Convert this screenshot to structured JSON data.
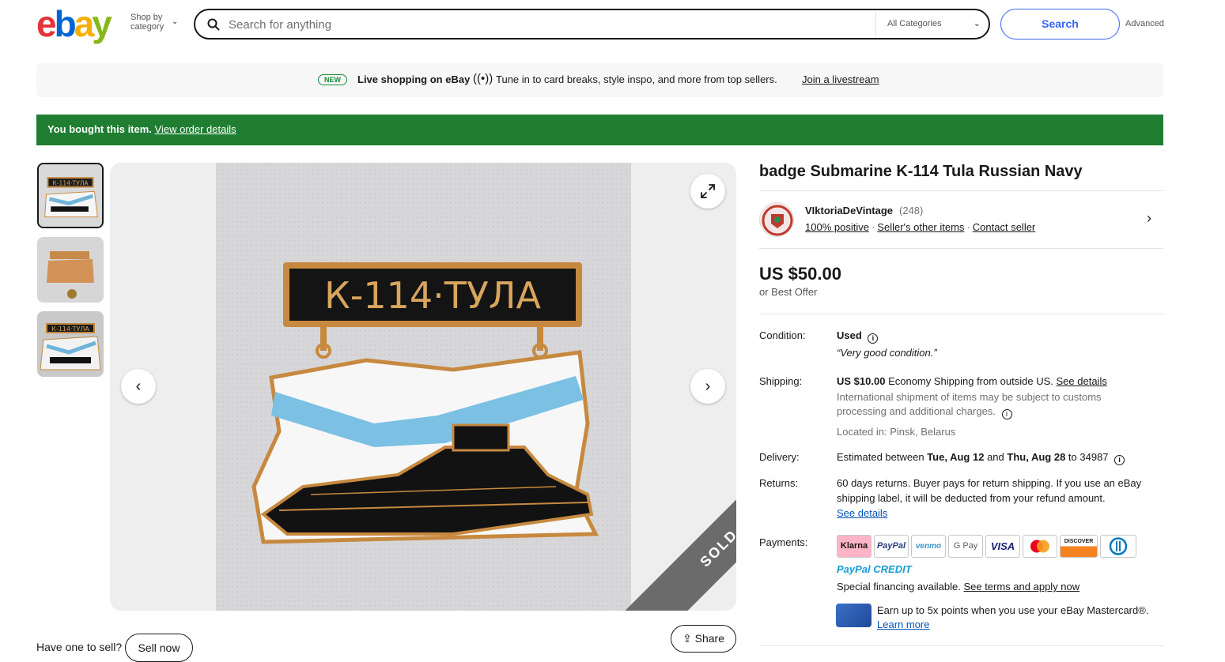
{
  "header": {
    "logo": {
      "e": "e",
      "b": "b",
      "a": "a",
      "y": "y"
    },
    "shop_by_line1": "Shop by",
    "shop_by_line2": "category",
    "search_placeholder": "Search for anything",
    "category_select": "All Categories",
    "search_button": "Search",
    "advanced_link": "Advanced"
  },
  "live_banner": {
    "badge": "NEW",
    "title": "Live shopping on eBay",
    "text": "Tune in to card breaks, style inspo, and more from top sellers.",
    "link": "Join a livestream"
  },
  "purchase_bar": {
    "text": "You bought this item.",
    "link": "View order details",
    "color": "#1f7e32"
  },
  "gallery": {
    "badge_text": "К-114·ТУЛА",
    "sold_label": "SOLD",
    "thumbnails": [
      "front",
      "back",
      "angled"
    ]
  },
  "listing": {
    "title": "badge Submarine K-114 Tula Russian Navy",
    "seller": {
      "name": "VIktoriaDeVintage",
      "count": "(248)",
      "positive": "100% positive",
      "other_items": "Seller's other items",
      "contact": "Contact seller"
    },
    "price": "US $50.00",
    "best_offer": "or Best Offer",
    "condition": {
      "label": "Condition:",
      "value": "Used",
      "note": "“Very good condition.”"
    },
    "shipping": {
      "label": "Shipping:",
      "amount": "US $10.00",
      "method": "Economy Shipping from outside US.",
      "details_link": "See details",
      "customs_line1": "International shipment of items may be subject to customs",
      "customs_line2": "processing and additional charges.",
      "location": "Located in: Pinsk, Belarus"
    },
    "delivery": {
      "label": "Delivery:",
      "prefix": "Estimated between",
      "start": "Tue, Aug 12",
      "and": "and",
      "end": "Thu, Aug 28",
      "to": "to 34987"
    },
    "returns": {
      "label": "Returns:",
      "line1": "60 days returns. Buyer pays for return shipping. If you use an eBay",
      "line2": "shipping label, it will be deducted from your refund amount.",
      "link": "See details"
    },
    "payments": {
      "label": "Payments:",
      "methods": [
        "Klarna",
        "PayPal",
        "venmo",
        "G Pay",
        "VISA",
        "Mastercard",
        "DISCOVER",
        "Diners Club"
      ],
      "paypal_credit_1": "PayPal",
      "paypal_credit_2": "CREDIT",
      "financing_text": "Special financing available.",
      "financing_link": "See terms and apply now",
      "earn_text": "Earn up to 5x points when you use your eBay Mastercard®.",
      "earn_link": "Learn more"
    }
  },
  "bottom": {
    "have_one": "Have one to sell?",
    "sell_now": "Sell now",
    "share": "Share"
  }
}
